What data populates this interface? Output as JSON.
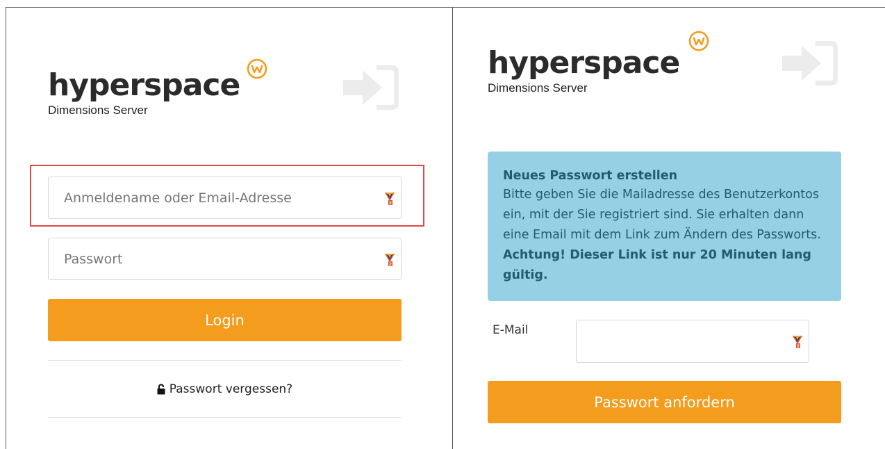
{
  "brand": {
    "name": "hyperspace",
    "subtitle": "Dimensions Server"
  },
  "login": {
    "username_placeholder": "Anmeldename oder Email-Adresse",
    "password_placeholder": "Passwort",
    "login_label": "Login",
    "forgot_label": "Passwort vergessen?"
  },
  "reset": {
    "info_title": "Neues Passwort erstellen",
    "info_text": "Bitte geben Sie die Mailadresse des Benutzerkontos ein, mit der Sie registriert sind. Sie erhalten dann eine Email mit dem Link zum Ändern des Passworts.",
    "info_warning": "Achtung! Dieser Link ist nur 20 Minuten lang gültig.",
    "email_label": "E-Mail",
    "email_value": "",
    "submit_label": "Passwort anfordern"
  },
  "colors": {
    "accent": "#f39c1e",
    "highlight": "#e04a43",
    "info_bg": "#96d0e5",
    "info_text": "#245b74"
  },
  "icons": [
    "hyperspace-badge-icon",
    "login-arrow-icon",
    "password-manager-icon",
    "unlock-icon"
  ]
}
